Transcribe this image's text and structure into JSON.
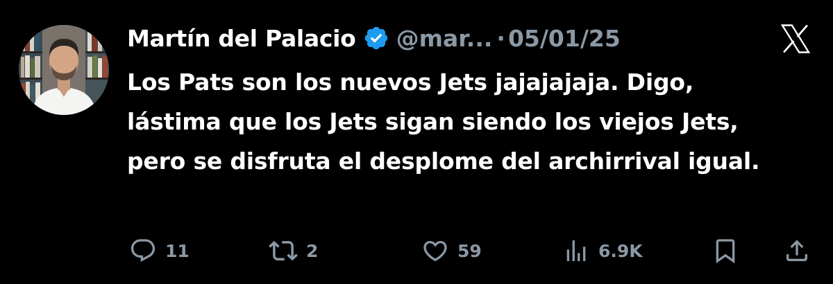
{
  "colors": {
    "background": "#000000",
    "text": "#ffffff",
    "secondary": "#8b98a5",
    "verified": "#1d9bf0"
  },
  "author": {
    "display_name": "Martín del Palacio",
    "handle": "@mar...",
    "verified_icon": "verified-badge-icon",
    "avatar_icon": "avatar"
  },
  "meta": {
    "separator": "·",
    "date": "05/01/25",
    "platform_icon": "x-logo-icon"
  },
  "tweet": {
    "text": "Los Pats son los nuevos Jets jajajajaja. Digo, lástima que los Jets sigan siendo los viejos Jets, pero se disfruta el desplome del archirrival igual."
  },
  "actions": {
    "reply": {
      "icon": "reply-icon",
      "count": "11"
    },
    "retweet": {
      "icon": "retweet-icon",
      "count": "2"
    },
    "like": {
      "icon": "heart-icon",
      "count": "59"
    },
    "views": {
      "icon": "views-icon",
      "count": "6.9K"
    },
    "bookmark": {
      "icon": "bookmark-icon"
    },
    "share": {
      "icon": "share-icon"
    }
  }
}
